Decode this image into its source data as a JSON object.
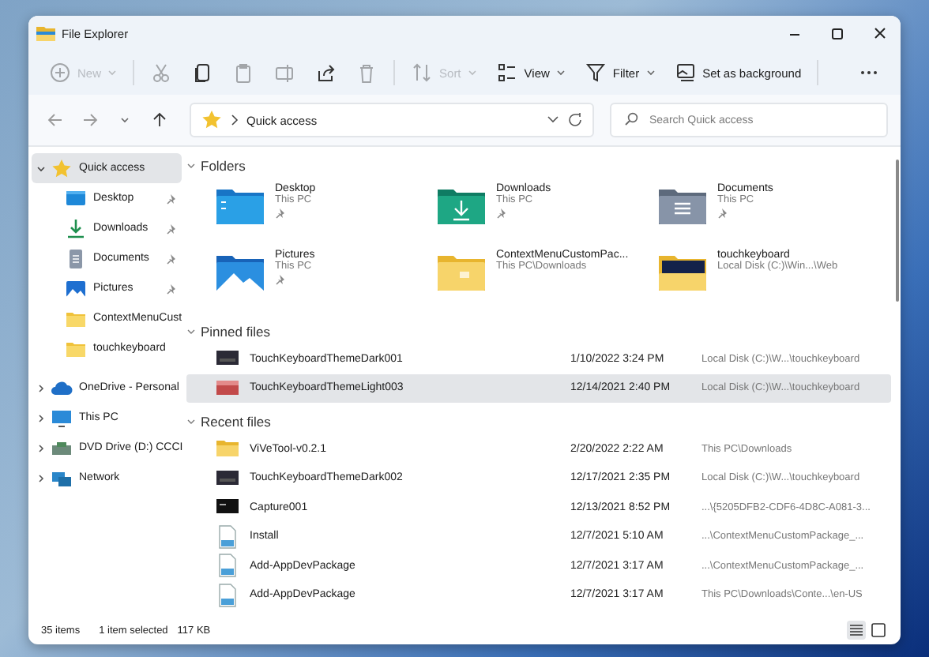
{
  "window": {
    "title": "File Explorer"
  },
  "toolbar": [
    {
      "label": "New",
      "disabled": true,
      "caret": true
    },
    {
      "disabled": true
    },
    {
      "disabled": false
    },
    {
      "disabled": true
    },
    {
      "disabled": true
    },
    {
      "disabled": false
    },
    {
      "disabled": true
    },
    {
      "label": "Sort",
      "disabled": true,
      "caret": true
    },
    {
      "label": "View",
      "disabled": false,
      "caret": true
    },
    {
      "label": "Filter",
      "disabled": false,
      "caret": true
    },
    {
      "label": "Set as background",
      "disabled": false,
      "caret": false
    },
    {
      "disabled": false
    }
  ],
  "navigation": {
    "back_disabled": true,
    "forward_disabled": true,
    "address": "Quick access",
    "search": {
      "placeholder": "Search Quick access"
    }
  },
  "sidebar": {
    "items": [
      {
        "label": "Quick access",
        "kind": "star",
        "expanded": true,
        "selected": true,
        "children": [
          {
            "label": "Desktop",
            "kind": "desktop",
            "pinned": true,
            "selected": false
          },
          {
            "label": "Downloads",
            "kind": "download",
            "pinned": true,
            "selected": false
          },
          {
            "label": "Documents",
            "kind": "documents",
            "pinned": true,
            "selected": false
          },
          {
            "label": "Pictures",
            "kind": "pictures",
            "pinned": true,
            "selected": false
          },
          {
            "label": "ContextMenuCust",
            "kind": "folder",
            "pinned": false,
            "selected": false
          },
          {
            "label": "touchkeyboard",
            "kind": "folder",
            "pinned": false,
            "selected": false
          }
        ]
      },
      {
        "label": "OneDrive - Personal",
        "kind": "cloud",
        "expanded": false,
        "selected": false
      },
      {
        "label": "This PC",
        "kind": "pc",
        "expanded": false,
        "selected": false
      },
      {
        "label": "DVD Drive (D:) CCCI",
        "kind": "drive",
        "expanded": false,
        "selected": false
      },
      {
        "label": "Network",
        "kind": "network",
        "expanded": false,
        "selected": false
      }
    ]
  },
  "folders": {
    "title": "Folders",
    "expanded": true,
    "items": [
      {
        "name": "Desktop",
        "location": "This PC",
        "pinned": true,
        "kind": "desktop"
      },
      {
        "name": "Downloads",
        "location": "This PC",
        "pinned": true,
        "kind": "download"
      },
      {
        "name": "Documents",
        "location": "This PC",
        "pinned": true,
        "kind": "documents"
      },
      {
        "name": "Pictures",
        "location": "This PC",
        "pinned": true,
        "kind": "pictures"
      },
      {
        "name": "ContextMenuCustomPac...",
        "location": "This PC\\Downloads",
        "pinned": false,
        "kind": "folder"
      },
      {
        "name": "touchkeyboard",
        "location": "Local Disk (C:)\\Win...\\Web",
        "pinned": false,
        "kind": "dark-folder"
      }
    ]
  },
  "pinned_files": {
    "title": "Pinned files",
    "expanded": true,
    "rows": [
      {
        "name": "TouchKeyboardThemeDark001",
        "date": "1/10/2022 3:24 PM",
        "location": "Local Disk (C:)\\W...\\touchkeyboard",
        "kind": "dark-image",
        "selected": false
      },
      {
        "name": "TouchKeyboardThemeLight003",
        "date": "12/14/2021 2:40 PM",
        "location": "Local Disk (C:)\\W...\\touchkeyboard",
        "kind": "light-image",
        "selected": true
      }
    ]
  },
  "recent_files": {
    "title": "Recent files",
    "expanded": true,
    "rows": [
      {
        "name": "ViVeTool-v0.2.1",
        "date": "2/20/2022 2:22 AM",
        "location": "This PC\\Downloads",
        "kind": "folder",
        "selected": false
      },
      {
        "name": "TouchKeyboardThemeDark002",
        "date": "12/17/2021 2:35 PM",
        "location": "Local Disk (C:)\\W...\\touchkeyboard",
        "kind": "dark-image",
        "selected": false
      },
      {
        "name": "Capture001",
        "date": "12/13/2021 8:52 PM",
        "location": "...\\{5205DFB2-CDF6-4D8C-A081-3...",
        "kind": "black-image",
        "selected": false
      },
      {
        "name": "Install",
        "date": "12/7/2021 5:10 AM",
        "location": "...\\ContextMenuCustomPackage_...",
        "kind": "script",
        "selected": false
      },
      {
        "name": "Add-AppDevPackage",
        "date": "12/7/2021 3:17 AM",
        "location": "...\\ContextMenuCustomPackage_...",
        "kind": "script",
        "selected": false
      },
      {
        "name": "Add-AppDevPackage",
        "date": "12/7/2021 3:17 AM",
        "location": "This PC\\Downloads\\Conte...\\en-US",
        "kind": "script",
        "selected": false
      }
    ]
  },
  "status_bar": {
    "count": "35 items",
    "selection": "1 item selected",
    "size": "117 KB",
    "views": [
      {
        "selected": true
      },
      {
        "selected": false
      }
    ]
  }
}
